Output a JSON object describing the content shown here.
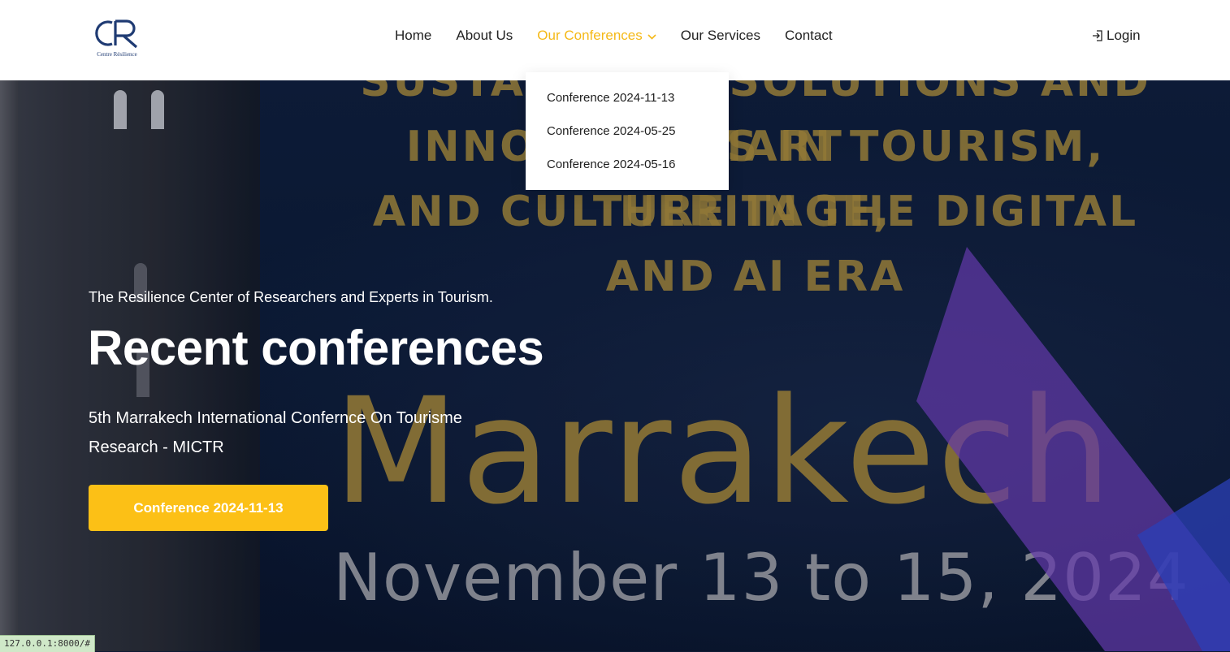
{
  "brand": {
    "logo_letters": "CR",
    "logo_subtitle": "Centre Résilience"
  },
  "nav": {
    "items": [
      {
        "label": "Home"
      },
      {
        "label": "About Us"
      },
      {
        "label": "Our Conferences",
        "active": true
      },
      {
        "label": "Our Services"
      },
      {
        "label": "Contact"
      }
    ],
    "login_label": "Login"
  },
  "dropdown": {
    "items": [
      {
        "label": "Conference 2024-11-13"
      },
      {
        "label": "Conference 2024-05-25"
      },
      {
        "label": "Conference 2024-05-16"
      }
    ]
  },
  "hero": {
    "tagline": "The Resilience Center of Researchers and Experts in Tourism.",
    "title": "Recent conferences",
    "subtitle": "5th Marrakech International Confernce On Tourisme Research - MICTR",
    "cta_label": "Conference 2024-11-13",
    "background": {
      "headline_lines": [
        "SUSTAINABLE SOLUTIONS AND SMART",
        "INNOVATIONS IN TOURISM, HERITAGE,",
        "AND CULTURE IN THE DIGITAL",
        "AND AI ERA"
      ],
      "city": "Marrakech",
      "dates": "November 13 to 15, 2024"
    }
  },
  "status_bar": {
    "url": "127.0.0.1:8000/#"
  },
  "colors": {
    "accent": "#f5b918",
    "cta": "#fcc016",
    "brand": "#1f3b73",
    "hero_bg": "#0d1a33"
  },
  "icons": {
    "dropdown": "chevron-down-icon",
    "login": "login-icon"
  }
}
